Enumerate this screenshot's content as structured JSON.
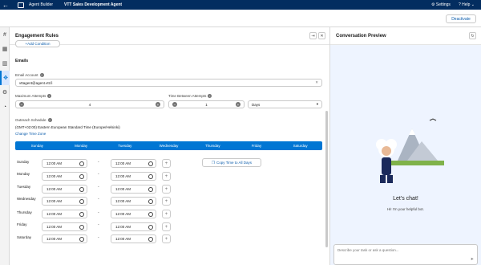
{
  "topbar": {
    "app_name": "Agent Builder",
    "agent_name": "VTT Sales Development Agent",
    "settings_label": "Settings",
    "help_label": "Help"
  },
  "subbar": {
    "deactivate_label": "Deactivate"
  },
  "panel": {
    "title": "Engagement Rules",
    "add_condition_label": "Add Condition",
    "section_title": "Emails",
    "email_account": {
      "label": "Email Account",
      "value": "vttagent@agent.vtt.fi"
    },
    "max_attempts": {
      "label": "Maximum Attempts",
      "value": "4"
    },
    "time_between": {
      "label": "Time Between Attempts",
      "value": "1",
      "unit": "Days"
    },
    "outreach": {
      "label": "Outreach Schedule",
      "timezone": "(GMT+02:00) Eastern European Standard Time (Europe/Helsinki)",
      "change_tz_label": "Change Time Zone"
    },
    "days_header": [
      "Sunday",
      "Monday",
      "Tuesday",
      "Wednesday",
      "Thursday",
      "Friday",
      "Saturday"
    ],
    "schedule": [
      {
        "day": "Sunday",
        "start": "12:00 AM",
        "end": "12:00 AM"
      },
      {
        "day": "Monday",
        "start": "12:00 AM",
        "end": "12:00 AM"
      },
      {
        "day": "Tuesday",
        "start": "12:00 AM",
        "end": "12:00 AM"
      },
      {
        "day": "Wednesday",
        "start": "12:00 AM",
        "end": "12:00 AM"
      },
      {
        "day": "Thursday",
        "start": "12:00 AM",
        "end": "12:00 AM"
      },
      {
        "day": "Friday",
        "start": "12:00 AM",
        "end": "12:00 AM"
      },
      {
        "day": "Saturday",
        "start": "12:00 AM",
        "end": "12:00 AM"
      }
    ],
    "copy_time_label": "Copy Time to All Days"
  },
  "conversation": {
    "title": "Conversation Preview",
    "heading": "Let's chat!",
    "greeting": "Hi! I'm your helpful bot.",
    "input_placeholder": "Describe your task or ask a question..."
  },
  "colors": {
    "nav": "#032d60",
    "brand": "#0176d3",
    "link": "#0b5cab"
  }
}
